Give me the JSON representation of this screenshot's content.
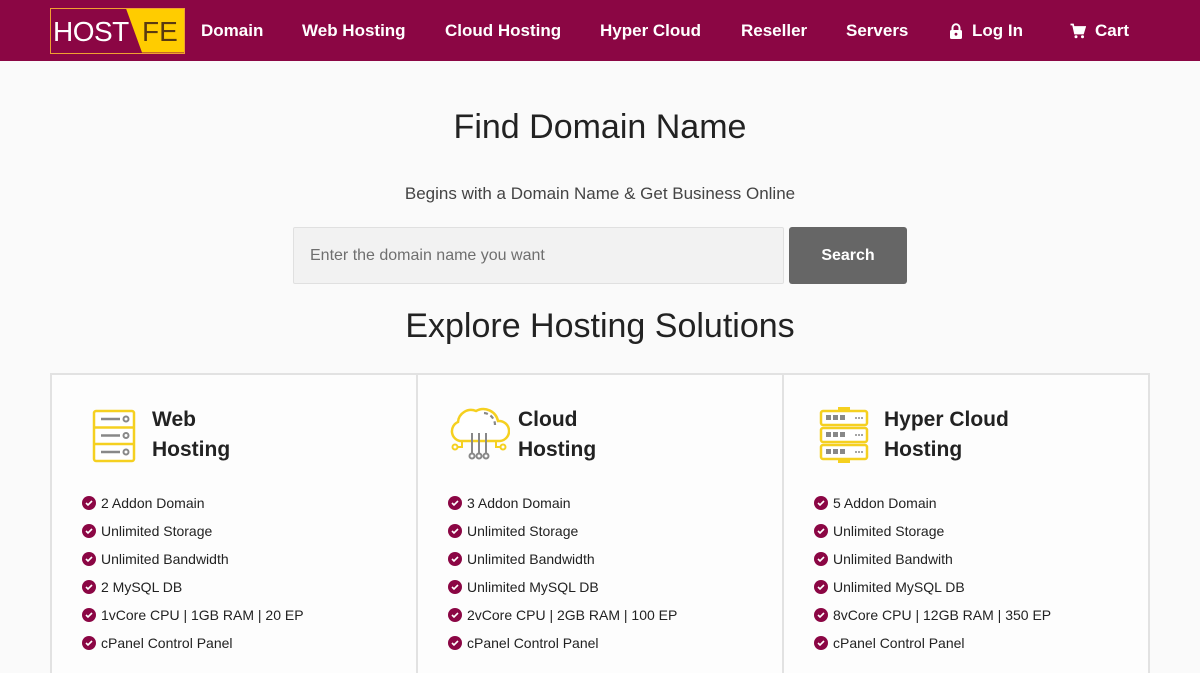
{
  "brand": {
    "logo_left": "HOST",
    "logo_right": "FE",
    "accent": "#8b0644",
    "logo_yellow": "#ffcc00"
  },
  "nav": {
    "items": [
      {
        "label": "Domain"
      },
      {
        "label": "Web Hosting"
      },
      {
        "label": "Cloud Hosting"
      },
      {
        "label": "Hyper Cloud"
      },
      {
        "label": "Reseller"
      },
      {
        "label": "Servers"
      },
      {
        "label": "Log In",
        "icon": "lock-icon"
      },
      {
        "label": "Cart",
        "icon": "cart-icon"
      }
    ]
  },
  "hero": {
    "title": "Find Domain Name",
    "subtitle": "Begins with a Domain Name & Get Business Online",
    "search_placeholder": "Enter the domain name you want",
    "search_value": "",
    "search_button": "Search"
  },
  "explore": {
    "title": "Explore Hosting Solutions",
    "cards": [
      {
        "title_line1": "Web",
        "title_line2": "Hosting",
        "icon": "server-stack-icon",
        "features": [
          "2 Addon Domain",
          "Unlimited Storage",
          "Unlimited Bandwidth",
          "2 MySQL DB",
          "1vCore CPU | 1GB RAM | 20 EP",
          "cPanel Control Panel"
        ]
      },
      {
        "title_line1": "Cloud",
        "title_line2": "Hosting",
        "icon": "cloud-network-icon",
        "features": [
          "3 Addon Domain",
          "Unlimited Storage",
          "Unlimited Bandwidth",
          "Unlimited MySQL DB",
          "2vCore CPU | 2GB RAM | 100 EP",
          "cPanel Control Panel"
        ]
      },
      {
        "title_line1": "Hyper Cloud",
        "title_line2": "Hosting",
        "icon": "server-rack-icon",
        "features": [
          "5 Addon Domain",
          "Unlimited Storage",
          "Unlimited Bandwith",
          "Unlimited MySQL DB",
          "8vCore CPU | 12GB RAM | 350 EP",
          "cPanel Control Panel"
        ]
      }
    ]
  }
}
